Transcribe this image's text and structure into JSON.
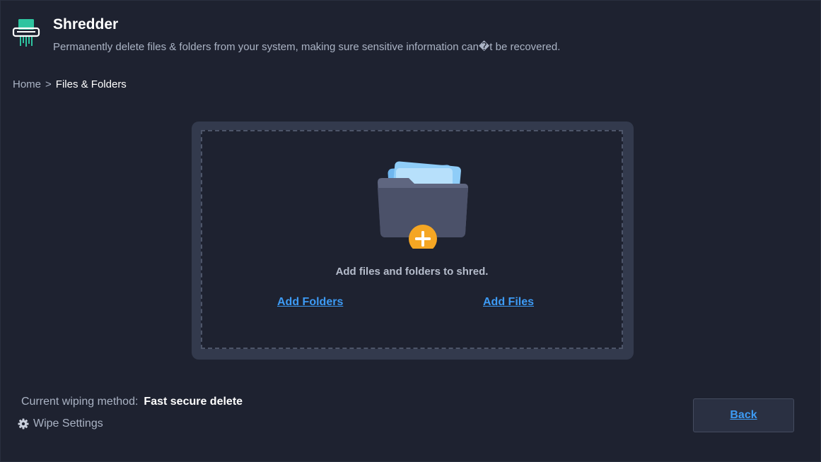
{
  "header": {
    "icon": "shredder-icon",
    "title": "Shredder",
    "subtitle": "Permanently delete files & folders from your system, making sure sensitive information can�t be recovered."
  },
  "breadcrumb": {
    "home": "Home",
    "separator": ">",
    "current": "Files & Folders"
  },
  "dropzone": {
    "icon": "folder-add-icon",
    "prompt": "Add files and folders to shred.",
    "add_folders_label": "Add Folders",
    "add_files_label": "Add Files"
  },
  "footer": {
    "method_label": "Current wiping method:",
    "method_value": "Fast secure delete",
    "settings_icon": "gear-icon",
    "settings_label": "Wipe Settings",
    "back_label": "Back"
  },
  "colors": {
    "background": "#1e2230",
    "accent_green": "#2ec4a0",
    "link_blue": "#3d9bf5",
    "plus_orange": "#f5a623"
  }
}
